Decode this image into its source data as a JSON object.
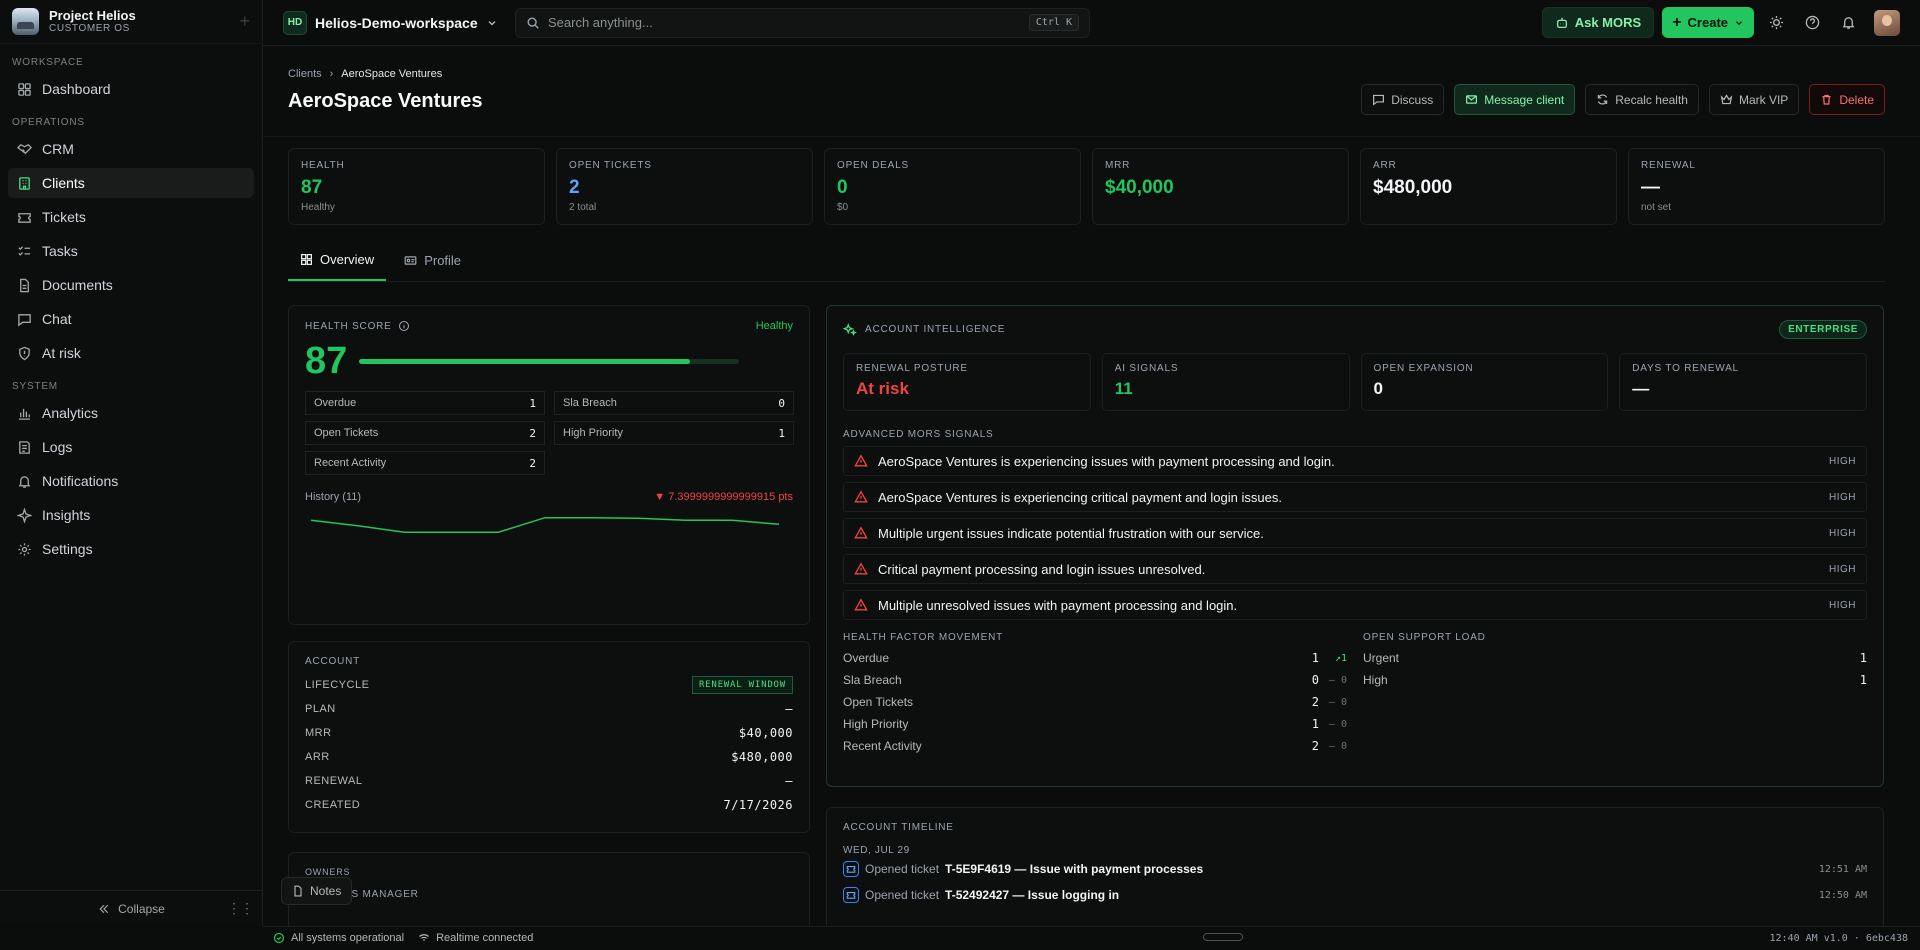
{
  "brand": {
    "title": "Project Helios",
    "subtitle": "CUSTOMER OS"
  },
  "sidebar": {
    "sections": [
      {
        "label": "WORKSPACE",
        "items": [
          {
            "label": "Dashboard",
            "icon": "dashboard-icon"
          }
        ]
      },
      {
        "label": "OPERATIONS",
        "items": [
          {
            "label": "CRM",
            "icon": "handshake-icon"
          },
          {
            "label": "Clients",
            "icon": "building-icon",
            "active": true
          },
          {
            "label": "Tickets",
            "icon": "ticket-icon"
          },
          {
            "label": "Tasks",
            "icon": "checklist-icon"
          },
          {
            "label": "Documents",
            "icon": "document-icon"
          },
          {
            "label": "Chat",
            "icon": "chat-icon"
          },
          {
            "label": "At risk",
            "icon": "shield-icon"
          }
        ]
      },
      {
        "label": "SYSTEM",
        "items": [
          {
            "label": "Analytics",
            "icon": "bar-chart-icon"
          },
          {
            "label": "Logs",
            "icon": "logs-icon"
          },
          {
            "label": "Notifications",
            "icon": "bell-icon"
          },
          {
            "label": "Insights",
            "icon": "sparkle-icon"
          },
          {
            "label": "Settings",
            "icon": "gear-icon"
          }
        ]
      }
    ],
    "collapse_label": "Collapse"
  },
  "topbar": {
    "workspace_initials": "HD",
    "workspace_name": "Helios-Demo-workspace",
    "search_placeholder": "Search anything...",
    "search_shortcut": "Ctrl K",
    "ask_label": "Ask MORS",
    "create_label": "Create"
  },
  "page": {
    "breadcrumb_parent": "Clients",
    "breadcrumb_current": "AeroSpace Ventures",
    "title": "AeroSpace Ventures",
    "actions": {
      "discuss": "Discuss",
      "message": "Message client",
      "recalc": "Recalc health",
      "vip": "Mark VIP",
      "delete": "Delete"
    }
  },
  "stats": [
    {
      "label": "HEALTH",
      "value": "87",
      "sub": "Healthy",
      "color": "#22c55e"
    },
    {
      "label": "OPEN TICKETS",
      "value": "2",
      "sub": "2 total",
      "color": "#60a5fa"
    },
    {
      "label": "OPEN DEALS",
      "value": "0",
      "sub": "$0",
      "color": "#22c55e"
    },
    {
      "label": "MRR",
      "value": "$40,000",
      "sub": "",
      "color": "#22c55e"
    },
    {
      "label": "ARR",
      "value": "$480,000",
      "sub": "",
      "color": "#f3f4f6"
    },
    {
      "label": "RENEWAL",
      "value": "—",
      "sub": "not set",
      "color": "#f3f4f6"
    }
  ],
  "tabs": {
    "overview": "Overview",
    "profile": "Profile"
  },
  "health": {
    "label": "HEALTH SCORE",
    "status": "Healthy",
    "score": "87",
    "score_fraction": 0.87,
    "factors": [
      {
        "label": "Overdue",
        "value": "1"
      },
      {
        "label": "Sla Breach",
        "value": "0"
      },
      {
        "label": "Open Tickets",
        "value": "2"
      },
      {
        "label": "High Priority",
        "value": "1"
      },
      {
        "label": "Recent Activity",
        "value": "2"
      }
    ],
    "history_label": "History (11)",
    "history_delta": "7.3999999999999915 pts",
    "history_values": [
      94.4,
      93.6,
      92.6,
      92.6,
      92.6,
      94.8,
      94.8,
      94.7,
      94.4,
      94.4,
      93.8
    ]
  },
  "account": {
    "label": "ACCOUNT",
    "rows": [
      {
        "label": "LIFECYCLE",
        "value": "RENEWAL WINDOW",
        "badge": true
      },
      {
        "label": "PLAN",
        "value": "—"
      },
      {
        "label": "MRR",
        "value": "$40,000"
      },
      {
        "label": "ARR",
        "value": "$480,000"
      },
      {
        "label": "RENEWAL",
        "value": "—"
      },
      {
        "label": "CREATED",
        "value": "7/17/2026"
      }
    ]
  },
  "owners": {
    "label": "OWNERS",
    "sub_label": "SUCCESS MANAGER"
  },
  "notes_label": "Notes",
  "intel": {
    "label": "ACCOUNT INTELLIGENCE",
    "tier": "ENTERPRISE",
    "mini": [
      {
        "label": "RENEWAL POSTURE",
        "value": "At risk",
        "color": "#ef4444"
      },
      {
        "label": "AI SIGNALS",
        "value": "11",
        "color": "#22c55e"
      },
      {
        "label": "OPEN EXPANSION",
        "value": "0",
        "color": "#f3f4f6"
      },
      {
        "label": "DAYS TO RENEWAL",
        "value": "—",
        "color": "#f3f4f6"
      }
    ],
    "signals_label": "ADVANCED MORS SIGNALS",
    "signals": [
      {
        "text": "AeroSpace Ventures is experiencing issues with payment processing and login.",
        "severity": "HIGH"
      },
      {
        "text": "AeroSpace Ventures is experiencing critical payment and login issues.",
        "severity": "HIGH"
      },
      {
        "text": "Multiple urgent issues indicate potential frustration with our service.",
        "severity": "HIGH"
      },
      {
        "text": "Critical payment processing and login issues unresolved.",
        "severity": "HIGH"
      },
      {
        "text": "Multiple unresolved issues with payment processing and login.",
        "severity": "HIGH"
      }
    ],
    "movement_label": "HEALTH FACTOR MOVEMENT",
    "movement": [
      {
        "label": "Overdue",
        "value": "1",
        "delta": "1",
        "up": true
      },
      {
        "label": "Sla Breach",
        "value": "0",
        "delta": "0"
      },
      {
        "label": "Open Tickets",
        "value": "2",
        "delta": "0"
      },
      {
        "label": "High Priority",
        "value": "1",
        "delta": "0"
      },
      {
        "label": "Recent Activity",
        "value": "2",
        "delta": "0"
      }
    ],
    "support_label": "OPEN SUPPORT LOAD",
    "support": [
      {
        "label": "Urgent",
        "value": "1"
      },
      {
        "label": "High",
        "value": "1"
      }
    ]
  },
  "timeline": {
    "label": "ACCOUNT TIMELINE",
    "date": "WED, JUL 29",
    "events": [
      {
        "prefix": "Opened ticket",
        "title": "T-5E9F4619 — Issue with payment processes",
        "time": "12:51 AM"
      },
      {
        "prefix": "Opened ticket",
        "title": "T-52492427 — Issue logging in",
        "time": "12:50 AM"
      }
    ]
  },
  "status": {
    "systems": "All systems operational",
    "realtime": "Realtime connected",
    "right": "12:40 AM  v1.0 · 6ebc438"
  }
}
